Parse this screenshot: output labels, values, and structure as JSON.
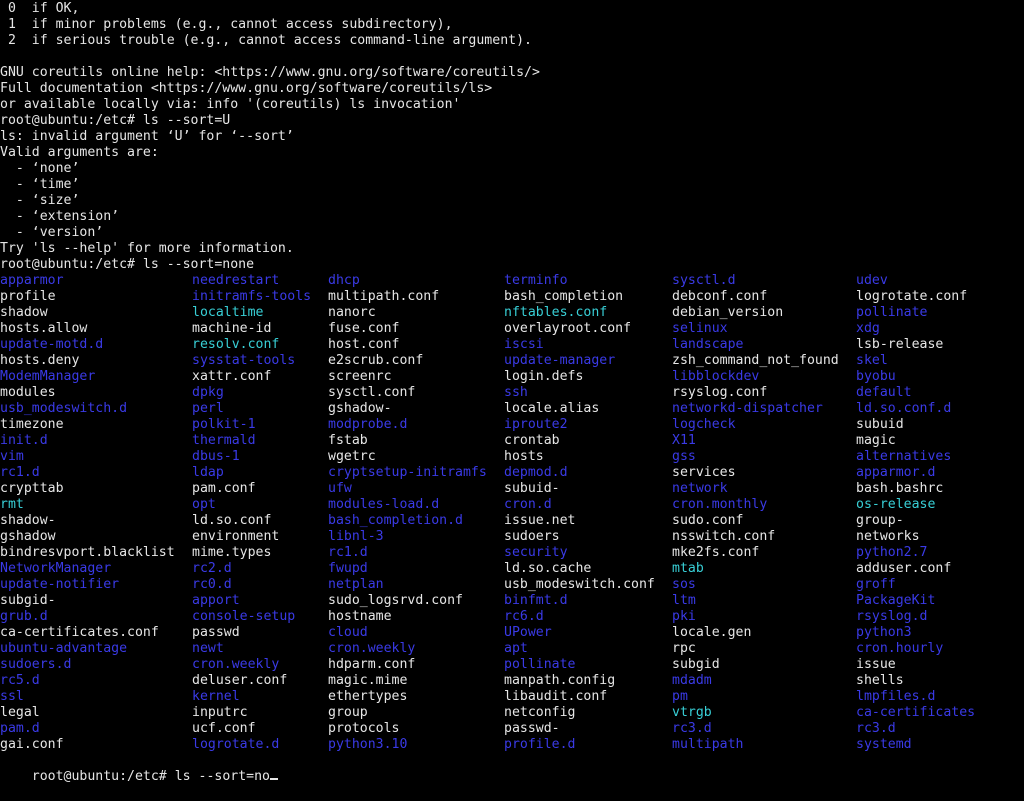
{
  "terminal": {
    "colors": {
      "background": "#000000",
      "text": "#e6e6e6",
      "directory": "#3a3ae6",
      "symlink": "#38cfd6"
    },
    "header_lines": [
      " 0  if OK,",
      " 1  if minor problems (e.g., cannot access subdirectory),",
      " 2  if serious trouble (e.g., cannot access command-line argument).",
      "",
      "GNU coreutils online help: <https://www.gnu.org/software/coreutils/>",
      "Full documentation <https://www.gnu.org/software/coreutils/ls>",
      "or available locally via: info '(coreutils) ls invocation'",
      "root@ubuntu:/etc# ls --sort=U",
      "ls: invalid argument ‘U’ for ‘--sort’",
      "Valid arguments are:",
      "  - ‘none’",
      "  - ‘time’",
      "  - ‘size’",
      "  - ‘extension’",
      "  - ‘version’",
      "Try 'ls --help' for more information.",
      "root@ubuntu:/etc# ls --sort=none"
    ],
    "listing_rows": [
      [
        [
          "apparmor",
          "dir"
        ],
        [
          "needrestart",
          "dir"
        ],
        [
          "dhcp",
          "dir"
        ],
        [
          "terminfo",
          "dir"
        ],
        [
          "sysctl.d",
          "dir"
        ],
        [
          "udev",
          "dir"
        ]
      ],
      [
        [
          "profile",
          "file"
        ],
        [
          "initramfs-tools",
          "dir"
        ],
        [
          "multipath.conf",
          "file"
        ],
        [
          "bash_completion",
          "file"
        ],
        [
          "debconf.conf",
          "file"
        ],
        [
          "logrotate.conf",
          "file"
        ]
      ],
      [
        [
          "shadow",
          "file"
        ],
        [
          "localtime",
          "link"
        ],
        [
          "nanorc",
          "file"
        ],
        [
          "nftables.conf",
          "link"
        ],
        [
          "debian_version",
          "file"
        ],
        [
          "pollinate",
          "dir"
        ]
      ],
      [
        [
          "hosts.allow",
          "file"
        ],
        [
          "machine-id",
          "file"
        ],
        [
          "fuse.conf",
          "file"
        ],
        [
          "overlayroot.conf",
          "file"
        ],
        [
          "selinux",
          "dir"
        ],
        [
          "xdg",
          "dir"
        ]
      ],
      [
        [
          "update-motd.d",
          "dir"
        ],
        [
          "resolv.conf",
          "link"
        ],
        [
          "host.conf",
          "file"
        ],
        [
          "iscsi",
          "dir"
        ],
        [
          "landscape",
          "dir"
        ],
        [
          "lsb-release",
          "file"
        ]
      ],
      [
        [
          "hosts.deny",
          "file"
        ],
        [
          "sysstat-tools",
          "dir"
        ],
        [
          "e2scrub.conf",
          "file"
        ],
        [
          "update-manager",
          "dir"
        ],
        [
          "zsh_command_not_found",
          "file"
        ],
        [
          "skel",
          "dir"
        ]
      ],
      [
        [
          "ModemManager",
          "dir"
        ],
        [
          "xattr.conf",
          "file"
        ],
        [
          "screenrc",
          "file"
        ],
        [
          "login.defs",
          "file"
        ],
        [
          "libblockdev",
          "dir"
        ],
        [
          "byobu",
          "dir"
        ]
      ],
      [
        [
          "modules",
          "file"
        ],
        [
          "dpkg",
          "dir"
        ],
        [
          "sysctl.conf",
          "file"
        ],
        [
          "ssh",
          "dir"
        ],
        [
          "rsyslog.conf",
          "file"
        ],
        [
          "default",
          "dir"
        ]
      ],
      [
        [
          "usb_modeswitch.d",
          "dir"
        ],
        [
          "perl",
          "dir"
        ],
        [
          "gshadow-",
          "file"
        ],
        [
          "locale.alias",
          "file"
        ],
        [
          "networkd-dispatcher",
          "dir"
        ],
        [
          "ld.so.conf.d",
          "dir"
        ]
      ],
      [
        [
          "timezone",
          "file"
        ],
        [
          "polkit-1",
          "dir"
        ],
        [
          "modprobe.d",
          "dir"
        ],
        [
          "iproute2",
          "dir"
        ],
        [
          "logcheck",
          "dir"
        ],
        [
          "subuid",
          "file"
        ]
      ],
      [
        [
          "init.d",
          "dir"
        ],
        [
          "thermald",
          "dir"
        ],
        [
          "fstab",
          "file"
        ],
        [
          "crontab",
          "file"
        ],
        [
          "X11",
          "dir"
        ],
        [
          "magic",
          "file"
        ]
      ],
      [
        [
          "vim",
          "dir"
        ],
        [
          "dbus-1",
          "dir"
        ],
        [
          "wgetrc",
          "file"
        ],
        [
          "hosts",
          "file"
        ],
        [
          "gss",
          "dir"
        ],
        [
          "alternatives",
          "dir"
        ]
      ],
      [
        [
          "rc1.d",
          "dir"
        ],
        [
          "ldap",
          "dir"
        ],
        [
          "cryptsetup-initramfs",
          "dir"
        ],
        [
          "depmod.d",
          "dir"
        ],
        [
          "services",
          "file"
        ],
        [
          "apparmor.d",
          "dir"
        ]
      ],
      [
        [
          "crypttab",
          "file"
        ],
        [
          "pam.conf",
          "file"
        ],
        [
          "ufw",
          "dir"
        ],
        [
          "subuid-",
          "file"
        ],
        [
          "network",
          "dir"
        ],
        [
          "bash.bashrc",
          "file"
        ]
      ],
      [
        [
          "rmt",
          "link"
        ],
        [
          "opt",
          "dir"
        ],
        [
          "modules-load.d",
          "dir"
        ],
        [
          "cron.d",
          "dir"
        ],
        [
          "cron.monthly",
          "dir"
        ],
        [
          "os-release",
          "link"
        ]
      ],
      [
        [
          "shadow-",
          "file"
        ],
        [
          "ld.so.conf",
          "file"
        ],
        [
          "bash_completion.d",
          "dir"
        ],
        [
          "issue.net",
          "file"
        ],
        [
          "sudo.conf",
          "file"
        ],
        [
          "group-",
          "file"
        ]
      ],
      [
        [
          "gshadow",
          "file"
        ],
        [
          "environment",
          "file"
        ],
        [
          "libnl-3",
          "dir"
        ],
        [
          "sudoers",
          "file"
        ],
        [
          "nsswitch.conf",
          "file"
        ],
        [
          "networks",
          "file"
        ]
      ],
      [
        [
          "bindresvport.blacklist",
          "file"
        ],
        [
          "mime.types",
          "file"
        ],
        [
          "rc1.d",
          "dir"
        ],
        [
          "security",
          "dir"
        ],
        [
          "mke2fs.conf",
          "file"
        ],
        [
          "python2.7",
          "dir"
        ]
      ],
      [
        [
          "NetworkManager",
          "dir"
        ],
        [
          "rc2.d",
          "dir"
        ],
        [
          "fwupd",
          "dir"
        ],
        [
          "ld.so.cache",
          "file"
        ],
        [
          "mtab",
          "link"
        ],
        [
          "adduser.conf",
          "file"
        ]
      ],
      [
        [
          "update-notifier",
          "dir"
        ],
        [
          "rc0.d",
          "dir"
        ],
        [
          "netplan",
          "dir"
        ],
        [
          "usb_modeswitch.conf",
          "file"
        ],
        [
          "sos",
          "dir"
        ],
        [
          "groff",
          "dir"
        ]
      ],
      [
        [
          "subgid-",
          "file"
        ],
        [
          "apport",
          "dir"
        ],
        [
          "sudo_logsrvd.conf",
          "file"
        ],
        [
          "binfmt.d",
          "dir"
        ],
        [
          "ltm",
          "dir"
        ],
        [
          "PackageKit",
          "dir"
        ]
      ],
      [
        [
          "grub.d",
          "dir"
        ],
        [
          "console-setup",
          "dir"
        ],
        [
          "hostname",
          "file"
        ],
        [
          "rc6.d",
          "dir"
        ],
        [
          "pki",
          "dir"
        ],
        [
          "rsyslog.d",
          "dir"
        ]
      ],
      [
        [
          "ca-certificates.conf",
          "file"
        ],
        [
          "passwd",
          "file"
        ],
        [
          "cloud",
          "dir"
        ],
        [
          "UPower",
          "dir"
        ],
        [
          "locale.gen",
          "file"
        ],
        [
          "python3",
          "dir"
        ]
      ],
      [
        [
          "ubuntu-advantage",
          "dir"
        ],
        [
          "newt",
          "dir"
        ],
        [
          "cron.weekly",
          "dir"
        ],
        [
          "apt",
          "dir"
        ],
        [
          "rpc",
          "file"
        ],
        [
          "cron.hourly",
          "dir"
        ]
      ],
      [
        [
          "sudoers.d",
          "dir"
        ],
        [
          "cron.weekly",
          "dir"
        ],
        [
          "hdparm.conf",
          "file"
        ],
        [
          "pollinate",
          "dir"
        ],
        [
          "subgid",
          "file"
        ],
        [
          "issue",
          "file"
        ]
      ],
      [
        [
          "rc5.d",
          "dir"
        ],
        [
          "deluser.conf",
          "file"
        ],
        [
          "magic.mime",
          "file"
        ],
        [
          "manpath.config",
          "file"
        ],
        [
          "mdadm",
          "dir"
        ],
        [
          "shells",
          "file"
        ]
      ],
      [
        [
          "ssl",
          "dir"
        ],
        [
          "kernel",
          "dir"
        ],
        [
          "ethertypes",
          "file"
        ],
        [
          "libaudit.conf",
          "file"
        ],
        [
          "pm",
          "dir"
        ],
        [
          "lmpfiles.d",
          "dir"
        ]
      ],
      [
        [
          "legal",
          "file"
        ],
        [
          "inputrc",
          "file"
        ],
        [
          "group",
          "file"
        ],
        [
          "netconfig",
          "file"
        ],
        [
          "vtrgb",
          "link"
        ],
        [
          "ca-certificates",
          "dir"
        ]
      ],
      [
        [
          "pam.d",
          "dir"
        ],
        [
          "ucf.conf",
          "file"
        ],
        [
          "protocols",
          "file"
        ],
        [
          "passwd-",
          "file"
        ],
        [
          "rc3.d",
          "dir"
        ],
        [
          "rc3.d",
          "dir"
        ]
      ],
      [
        [
          "gai.conf",
          "file"
        ],
        [
          "logrotate.d",
          "dir"
        ],
        [
          "python3.10",
          "dir"
        ],
        [
          "profile.d",
          "dir"
        ],
        [
          "multipath",
          "dir"
        ],
        [
          "systemd",
          "dir"
        ]
      ]
    ],
    "prompt": "root@ubuntu:/etc# ",
    "current_input": "ls --sort=no"
  }
}
